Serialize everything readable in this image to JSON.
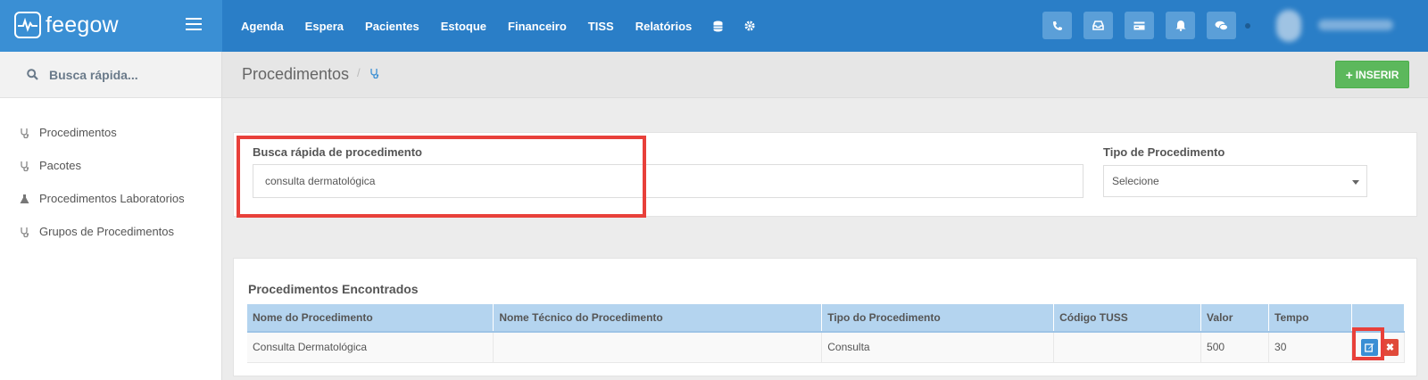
{
  "brand": {
    "name": "feegow"
  },
  "nav": {
    "items": [
      "Agenda",
      "Espera",
      "Pacientes",
      "Estoque",
      "Financeiro",
      "TISS",
      "Relatórios"
    ],
    "icons": [
      "database-icon",
      "gear-icon"
    ]
  },
  "toolbar": {
    "icons": [
      "phone-icon",
      "inbox-icon",
      "card-icon",
      "bell-icon",
      "chat-icon"
    ]
  },
  "sidebar": {
    "search_placeholder": "Busca rápida...",
    "items": [
      {
        "label": "Procedimentos",
        "icon": "stethoscope-icon"
      },
      {
        "label": "Pacotes",
        "icon": "stethoscope-icon"
      },
      {
        "label": "Procedimentos Laboratorios",
        "icon": "flask-icon"
      },
      {
        "label": "Grupos de Procedimentos",
        "icon": "stethoscope-icon"
      }
    ]
  },
  "page": {
    "title": "Procedimentos",
    "breadcrumb_sep": "/",
    "insert_label": "INSERIR"
  },
  "filters": {
    "search_label": "Busca rápida de procedimento",
    "search_value": "consulta dermatológica",
    "type_label": "Tipo de Procedimento",
    "type_value": "Selecione"
  },
  "results": {
    "title": "Procedimentos Encontrados",
    "columns": [
      "Nome do Procedimento",
      "Nome Técnico do Procedimento",
      "Tipo do Procedimento",
      "Código TUSS",
      "Valor",
      "Tempo"
    ],
    "rows": [
      {
        "nome": "Consulta Dermatológica",
        "tecnico": "",
        "tipo": "Consulta",
        "tuss": "",
        "valor": "500",
        "tempo": "30"
      }
    ]
  },
  "colors": {
    "topbar": "#2a7ec7",
    "accent": "#3a8fd4",
    "success": "#5cb85c",
    "danger": "#e04a3a",
    "highlight": "#e8403a"
  }
}
